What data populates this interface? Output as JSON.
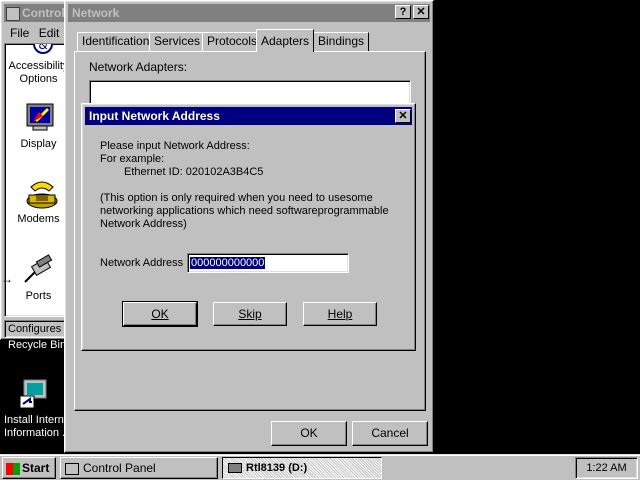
{
  "control_panel": {
    "title": "Control Panel",
    "menu": [
      "File",
      "Edit"
    ],
    "icons": [
      {
        "label_line1": "Accessibility",
        "label_line2": "Options",
        "icon": "accessibility-icon"
      },
      {
        "label_line1": "Display",
        "icon": "display-icon"
      },
      {
        "label_line1": "Modems",
        "icon": "modem-icon"
      },
      {
        "label_line1": "Ports",
        "icon": "ports-icon"
      }
    ],
    "status_text": "Configures n"
  },
  "desktop": {
    "recycle_bin_label": "Recycle Bin",
    "ie_label_line1": "Install Interne",
    "ie_label_line2": "Information ."
  },
  "network": {
    "title": "Network",
    "tabs": [
      "Identification",
      "Services",
      "Protocols",
      "Adapters",
      "Bindings"
    ],
    "active_tab": "Adapters",
    "adapters_label": "Network Adapters:",
    "ok_label": "OK",
    "cancel_label": "Cancel"
  },
  "dialog": {
    "title": "Input Network Address",
    "line1": "Please input Network Address:",
    "line2": "For example:",
    "line3": "Ethernet ID: 020102A3B4C5",
    "note1": "(This option is only required when you need to usesome",
    "note2": "networking applications which need softwareprogrammable",
    "note3": "Network Address)",
    "field_label": "Network Address",
    "field_value": "000000000000",
    "ok": "OK",
    "skip": "Skip",
    "help": "Help"
  },
  "taskbar": {
    "start": "Start",
    "tasks": [
      {
        "label": "Control Panel",
        "icon": "control-panel-icon"
      },
      {
        "label": "Rtl8139 (D:)",
        "icon": "drive-icon"
      }
    ],
    "clock": "1:22 AM"
  },
  "colors": {
    "desktop": "#000000",
    "window_face": "#c0c0c0",
    "title_active": "#000080",
    "title_inactive": "#808080",
    "selection": "#000080"
  }
}
